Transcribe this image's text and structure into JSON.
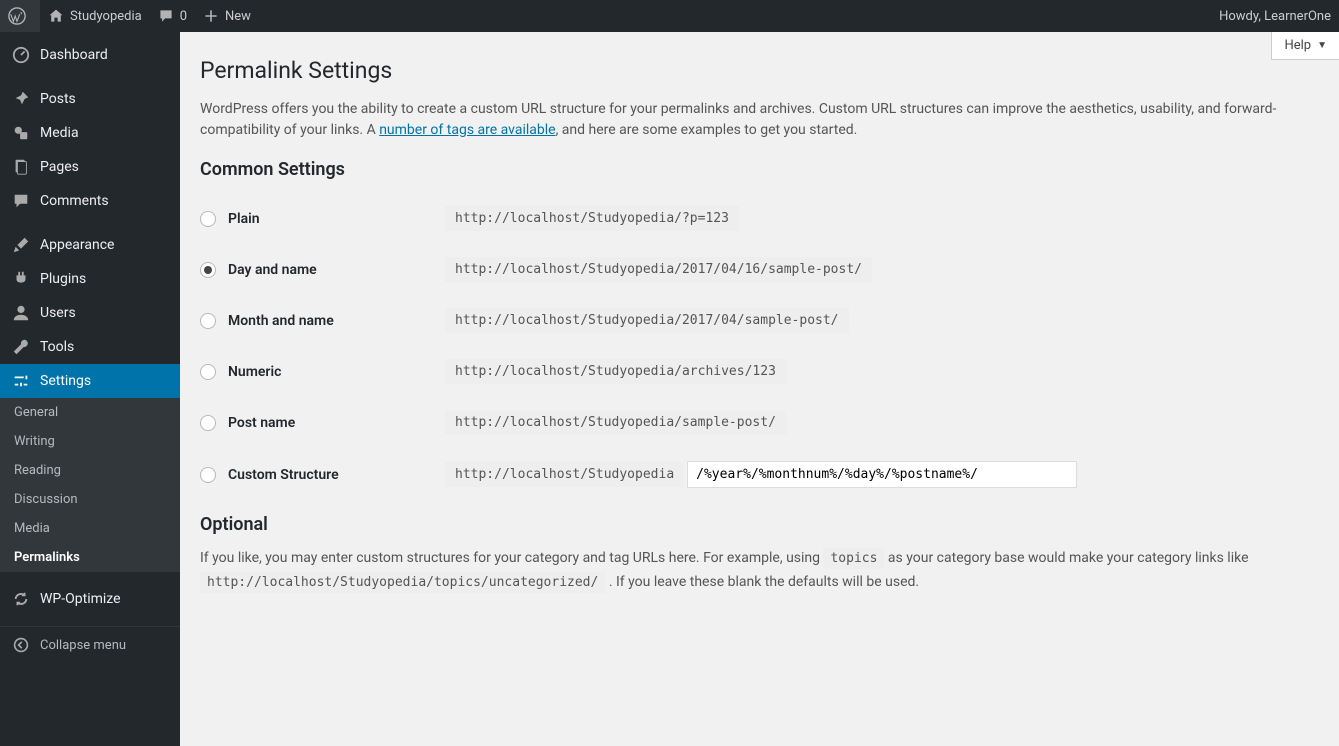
{
  "toolbar": {
    "site_name": "Studyopedia",
    "comments_count": "0",
    "new_label": "New",
    "howdy": "Howdy, LearnerOne"
  },
  "sidebar": {
    "dashboard": "Dashboard",
    "posts": "Posts",
    "media": "Media",
    "pages": "Pages",
    "comments": "Comments",
    "appearance": "Appearance",
    "plugins": "Plugins",
    "users": "Users",
    "tools": "Tools",
    "settings": "Settings",
    "submenu": {
      "general": "General",
      "writing": "Writing",
      "reading": "Reading",
      "discussion": "Discussion",
      "media": "Media",
      "permalinks": "Permalinks"
    },
    "wpoptimize": "WP-Optimize",
    "collapse": "Collapse menu"
  },
  "content": {
    "help": "Help",
    "title": "Permalink Settings",
    "desc1": "WordPress offers you the ability to create a custom URL structure for your permalinks and archives. Custom URL structures can improve the aesthetics, usability, and forward-compatibility of your links. A ",
    "desc_link": "number of tags are available",
    "desc2": ", and here are some examples to get you started.",
    "common_heading": "Common Settings",
    "options": [
      {
        "label": "Plain",
        "example": "http://localhost/Studyopedia/?p=123",
        "checked": false
      },
      {
        "label": "Day and name",
        "example": "http://localhost/Studyopedia/2017/04/16/sample-post/",
        "checked": true
      },
      {
        "label": "Month and name",
        "example": "http://localhost/Studyopedia/2017/04/sample-post/",
        "checked": false
      },
      {
        "label": "Numeric",
        "example": "http://localhost/Studyopedia/archives/123",
        "checked": false
      },
      {
        "label": "Post name",
        "example": "http://localhost/Studyopedia/sample-post/",
        "checked": false
      }
    ],
    "custom": {
      "label": "Custom Structure",
      "prefix": "http://localhost/Studyopedia",
      "value": "/%year%/%monthnum%/%day%/%postname%/"
    },
    "optional_heading": "Optional",
    "opt_text1": "If you like, you may enter custom structures for your category and tag URLs here. For example, using ",
    "opt_code1": "topics",
    "opt_text2": " as your category base would make your category links like ",
    "opt_code2": "http://localhost/Studyopedia/topics/uncategorized/",
    "opt_text3": " . If you leave these blank the defaults will be used."
  }
}
